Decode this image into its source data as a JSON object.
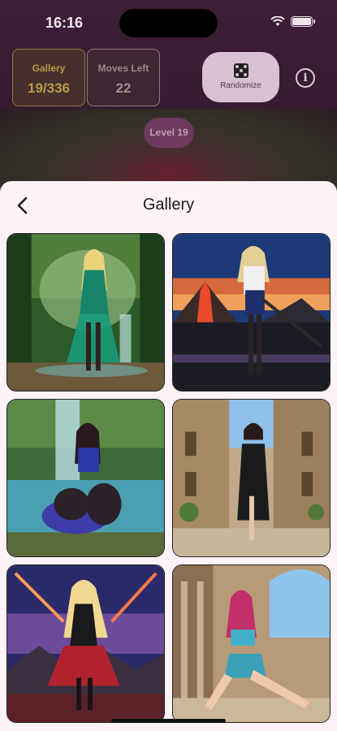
{
  "status_bar": {
    "time": "16:16"
  },
  "hud": {
    "gallery": {
      "label": "Gallery",
      "value": "19/336"
    },
    "moves": {
      "label": "Moves Left",
      "value": "22"
    },
    "randomize_label": "Randomize",
    "level_label": "Level 19"
  },
  "sheet": {
    "title": "Gallery",
    "images": [
      {
        "scene": "jungle waterfall",
        "accent": "#1f8a6a"
      },
      {
        "scene": "volcano sunset",
        "accent": "#2a3f8a"
      },
      {
        "scene": "blue waterfall cliff",
        "accent": "#3348a8"
      },
      {
        "scene": "old town street",
        "accent": "#1b1b1b"
      },
      {
        "scene": "neon sky battlefield",
        "accent": "#b0222e"
      },
      {
        "scene": "stone courtyard",
        "accent": "#3fa0b5"
      }
    ]
  }
}
